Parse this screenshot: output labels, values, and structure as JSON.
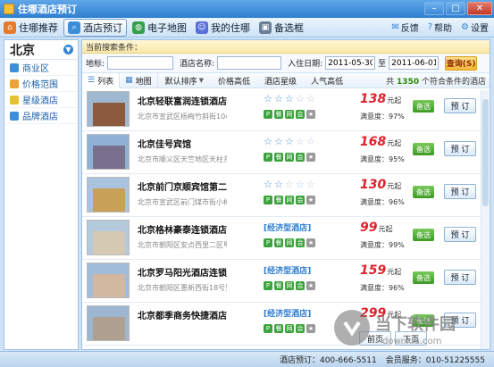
{
  "window": {
    "title": "住哪酒店预订"
  },
  "toolbar": {
    "items": [
      {
        "label": "住哪推荐",
        "icon": "home-icon",
        "color": "#e57a2b"
      },
      {
        "label": "酒店预订",
        "icon": "search-icon",
        "color": "#3b8ed8"
      },
      {
        "label": "电子地图",
        "icon": "globe-icon",
        "color": "#35a04a"
      },
      {
        "label": "我的住哪",
        "icon": "user-icon",
        "color": "#5b6fd8"
      },
      {
        "label": "备选框",
        "icon": "car-icon",
        "color": "#6b7f96"
      }
    ],
    "right": [
      {
        "label": "反馈",
        "icon": "mail-icon"
      },
      {
        "label": "帮助",
        "icon": "help-icon"
      },
      {
        "label": "设置",
        "icon": "gear-icon"
      }
    ]
  },
  "sidebar": {
    "city": "北京",
    "items": [
      {
        "label": "商业区",
        "color": "#3a8fd8"
      },
      {
        "label": "价格范围",
        "color": "#f0a230"
      },
      {
        "label": "星级酒店",
        "color": "#e6c32a"
      },
      {
        "label": "品牌酒店",
        "color": "#3a8fd8"
      }
    ]
  },
  "search": {
    "condition_label": "当前搜索条件：",
    "place_label": "地标:",
    "place_value": "",
    "hotel_label": "酒店名称:",
    "hotel_value": "",
    "checkin_label": "入住日期:",
    "checkin_value": "2011-05-30",
    "to_label": "至",
    "checkout_value": "2011-06-01",
    "button": "查询(S)"
  },
  "sort": {
    "views": [
      "列表",
      "地图"
    ],
    "items": [
      "默认排序",
      "价格高低",
      "酒店星级",
      "人气高低"
    ],
    "result_prefix": "共",
    "result_count": "1350",
    "result_suffix": "个符合条件的酒店"
  },
  "hotels": [
    {
      "name": "北京轻联富润连锁酒店",
      "address": "北京市宣武区杨梅竹斜街104",
      "stars": 3,
      "type": "",
      "price": "138",
      "unit": "元起",
      "satisfaction": "满意度：97%",
      "fav": "备选",
      "book": "预 订",
      "sky": "#9fb8cf",
      "building": "#8c5a3c"
    },
    {
      "name": "北京佳号宾馆",
      "address": "北京市顺义区天竺地区天柱东",
      "stars": 3,
      "type": "",
      "price": "168",
      "unit": "元起",
      "satisfaction": "满意度：95%",
      "fav": "备选",
      "book": "预 订",
      "sky": "#8fb1d6",
      "building": "#7a6f8d"
    },
    {
      "name": "北京前门京顺宾馆第二",
      "address": "北京市宣武区前门煤市街小椿树",
      "stars": 2,
      "type": "",
      "price": "130",
      "unit": "元起",
      "satisfaction": "满意度：96%",
      "fav": "备选",
      "book": "预 订",
      "sky": "#a9c3de",
      "building": "#c8a058"
    },
    {
      "name": "北京格林豪泰连锁酒店",
      "address": "北京市朝阳区安贞西里二区甲",
      "stars": 0,
      "type": "[经济型酒店]",
      "price": "99",
      "unit": "元起",
      "satisfaction": "满意度：99%",
      "fav": "备选",
      "book": "预 订",
      "sky": "#b5c9dd",
      "building": "#d6c9b4"
    },
    {
      "name": "北京罗马阳光酒店连锁",
      "address": "北京市朝阳区惠新西街18号罗马",
      "stars": 0,
      "type": "[经济型酒店]",
      "price": "159",
      "unit": "元起",
      "satisfaction": "满意度：96%",
      "fav": "备选",
      "book": "预 订",
      "sky": "#a0bcd8",
      "building": "#d2b8a0"
    },
    {
      "name": "北京都季商务快捷酒店",
      "address": "",
      "stars": 0,
      "type": "[经济型酒店]",
      "price": "299",
      "unit": "元起",
      "satisfaction": "",
      "fav": "备选",
      "book": "预 订",
      "sky": "#9db7d2",
      "building": "#b0a090"
    }
  ],
  "facility_colors": [
    "#3ba33b",
    "#3ba33b",
    "#3ba33b",
    "#3ba33b",
    "#999999"
  ],
  "pager": {
    "prev": "前页",
    "next": "下页"
  },
  "status": {
    "hotline": "酒店预订：400-666-5511",
    "service": "会员服务：010-51225555"
  },
  "watermark": {
    "text": "当下软件园",
    "url": "downxia.com"
  }
}
